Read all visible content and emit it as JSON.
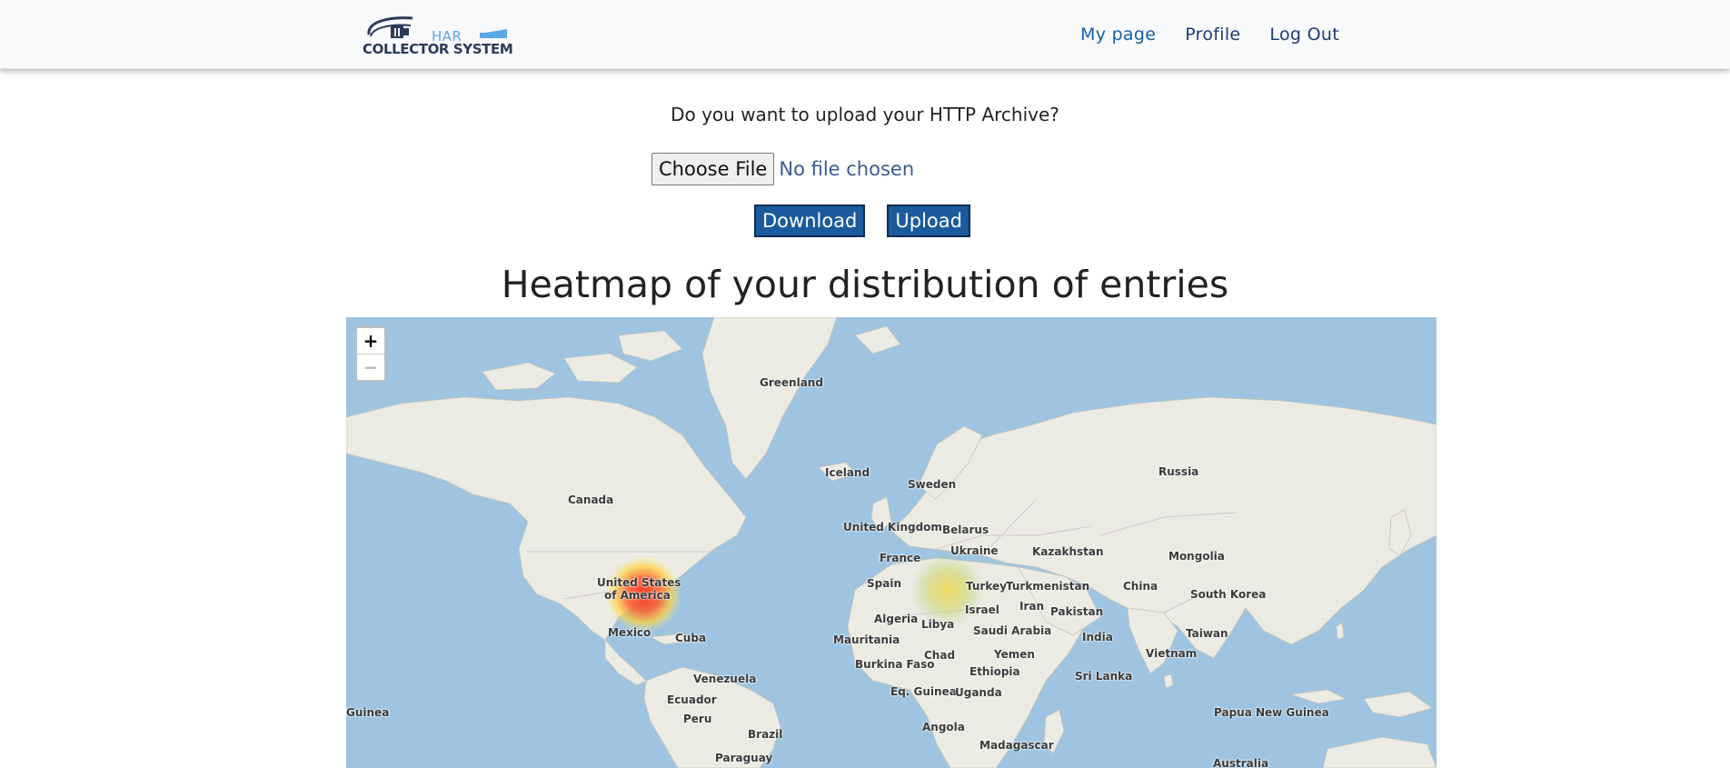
{
  "brand": {
    "line1": "HAR",
    "line2": "COLLECTOR SYSTEM"
  },
  "nav": {
    "my_page": "My page",
    "profile": "Profile",
    "logout": "Log Out"
  },
  "upload": {
    "question": "Do you want to upload your HTTP Archive?",
    "choose_file": "Choose File",
    "no_file": "No file chosen",
    "download": "Download",
    "upload": "Upload"
  },
  "heading": "Heatmap of your distribution of entries",
  "map": {
    "zoom_in": "+",
    "zoom_out": "−",
    "labels": {
      "greenland": "Greenland",
      "iceland": "Iceland",
      "sweden": "Sweden",
      "russia": "Russia",
      "canada": "Canada",
      "united_kingdom": "United Kingdom",
      "belarus": "Belarus",
      "ukraine": "Ukraine",
      "kazakhstan": "Kazakhstan",
      "mongolia": "Mongolia",
      "france": "France",
      "spain": "Spain",
      "turkey": "Turkey",
      "turkmenistan": "Turkmenistan",
      "china": "China",
      "south_korea": "South Korea",
      "usa_line1": "United States",
      "usa_line2": "of America",
      "israel": "Israel",
      "iran": "Iran",
      "pakistan": "Pakistan",
      "algeria": "Algeria",
      "libya": "Libya",
      "saudi_arabia": "Saudi Arabia",
      "india": "India",
      "taiwan": "Taiwan",
      "mexico": "Mexico",
      "cuba": "Cuba",
      "mauritania": "Mauritania",
      "vietnam": "Vietnam",
      "burkina_faso": "Burkina Faso",
      "chad": "Chad",
      "yemen": "Yemen",
      "venezuela": "Venezuela",
      "ethiopia": "Ethiopia",
      "sri_lanka": "Sri Lanka",
      "eq_guinea": "Eq. Guinea",
      "uganda": "Uganda",
      "ecuador": "Ecuador",
      "guinea": "Guinea",
      "papua_new_guinea": "Papua New Guinea",
      "peru": "Peru",
      "brazil": "Brazil",
      "angola": "Angola",
      "madagascar": "Madagascar",
      "paraguay": "Paraguay",
      "australia": "Australia"
    }
  },
  "colors": {
    "ocean": "#9ec4e1",
    "land": "#ecebe3",
    "button": "#1a5b9e",
    "nav_link": "#1f3b73"
  }
}
